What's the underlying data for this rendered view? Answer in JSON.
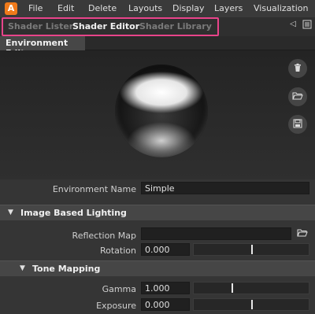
{
  "app": {
    "logo_letter": "A",
    "accent_color": "#f07a1a"
  },
  "menu": [
    "File",
    "Edit",
    "Delete",
    "Layouts",
    "Display",
    "Layers",
    "Visualization"
  ],
  "tabs": [
    {
      "label": "Shader Lister",
      "active": false
    },
    {
      "label": "Shader Editor",
      "active": true
    },
    {
      "label": "Shader Library",
      "active": false
    }
  ],
  "tab_highlight_color": "#e8448a",
  "subtab": {
    "label": "Environment Editor"
  },
  "preview": {
    "side_buttons": [
      "trash-icon",
      "folder-open-icon",
      "save-icon"
    ]
  },
  "environment": {
    "name_label": "Environment Name",
    "name_value": "Simple"
  },
  "ibl": {
    "title": "Image Based Lighting",
    "reflection_map_label": "Reflection Map",
    "reflection_map_value": "",
    "rotation_label": "Rotation",
    "rotation_value": "0.000",
    "rotation_slider": 0.5
  },
  "tone_mapping": {
    "title": "Tone Mapping",
    "gamma_label": "Gamma",
    "gamma_value": "1.000",
    "gamma_slider": 0.33,
    "exposure_label": "Exposure",
    "exposure_value": "0.000",
    "exposure_slider": 0.5
  }
}
